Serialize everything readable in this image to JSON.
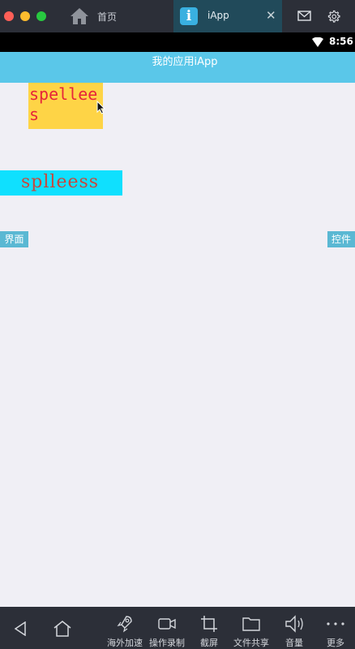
{
  "window": {
    "tabs": [
      {
        "label": "首页",
        "active": false
      },
      {
        "label": "iApp",
        "active": true
      }
    ],
    "active_tab_icon_letter": "i",
    "close_glyph": "✕"
  },
  "status_bar": {
    "time": "8:56"
  },
  "app_bar": {
    "title": "我的应用iApp"
  },
  "content": {
    "yellow_text": "spellees",
    "cyan_text": "splleess",
    "left_button_label": "界面",
    "right_button_label": "控件"
  },
  "toolbar": {
    "items": [
      {
        "label": "",
        "icon": "back-icon"
      },
      {
        "label": "",
        "icon": "home-icon"
      },
      {
        "label": "海外加速",
        "icon": "rocket-icon"
      },
      {
        "label": "操作录制",
        "icon": "video-icon"
      },
      {
        "label": "截屏",
        "icon": "crop-icon"
      },
      {
        "label": "文件共享",
        "icon": "folder-icon"
      },
      {
        "label": "音量",
        "icon": "volume-icon"
      },
      {
        "label": "更多",
        "icon": "more-icon"
      }
    ]
  },
  "colors": {
    "app_bar": "#5ac7e9",
    "yellow_box": "#fed446",
    "yellow_text": "#e6243a",
    "cyan_box": "#0fe0fe",
    "cyan_text": "#c7483c",
    "button_bg": "#5ab8d3",
    "chrome_bg": "#2c2f38"
  }
}
